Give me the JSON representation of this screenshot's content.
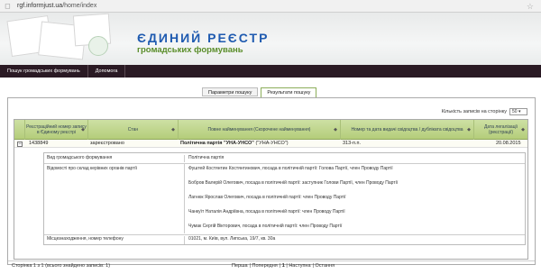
{
  "browser": {
    "url_prefix": "rgf.informjust.ua",
    "url_path": "/home/index"
  },
  "banner": {
    "title": "ЄДИНИЙ РЕЄСТР",
    "subtitle": "громадських формувань"
  },
  "navbar": {
    "items": [
      "Пошук громадських формувань",
      "Допомога"
    ]
  },
  "tabs": {
    "params": "Параметри пошуку",
    "results": "Результати пошуку"
  },
  "records_per_page": {
    "label": "Кількість записів на сторінку",
    "value": "50"
  },
  "grid": {
    "headers": [
      "Реєстраційний номер запису в Єдиному реєстрі",
      "Стан",
      "Повне найменування (Скорочене найменування)",
      "Номер та дата видачі свідоцтва / дубліката свідоцтва",
      "Дата легалізації (реєстрації)"
    ],
    "row": {
      "expander": "−",
      "number": "1438849",
      "status": "зареєстровано",
      "name_full": "Політична партія \"УНА-УНСО\"",
      "name_short": "(\"УНА-УНСО\")",
      "certificate": "313-п.п.",
      "date": "20.08.2015"
    }
  },
  "details": {
    "type_label": "Вид громадського формування",
    "type_value": "Політична партія",
    "leaders_label": "Відомості про склад керівних органів партії",
    "leaders": [
      "Фуштей Костянтин Костянтинович, посада в політичній партії: Голова Партії, член Проводу Партії",
      "Бобров Валерій Олегович, посада в політичній партії: заступник Голови Партії, член Проводу Партії",
      "Лагнюк Ярослав Олегович, посада в політичній партії: член Проводу Партії",
      "Чанкуїт Наталія Андріївна, посада в політичній партії: член Проводу Партії",
      "Чумак Сергій Вікторович, посада в політичній партії: член Проводу Партії"
    ],
    "address_label": "Місцезнаходження, номер телефону",
    "address_value": "01021, м. Київ, вул. Липська, 19/7, кв. 30а"
  },
  "pager": {
    "info": "Сторінка 1 з 1 (всього знайдено записів: 1)",
    "first": "Перша",
    "prev": "Попередня",
    "current": "1",
    "next": "Наступна",
    "last": "Остання"
  }
}
